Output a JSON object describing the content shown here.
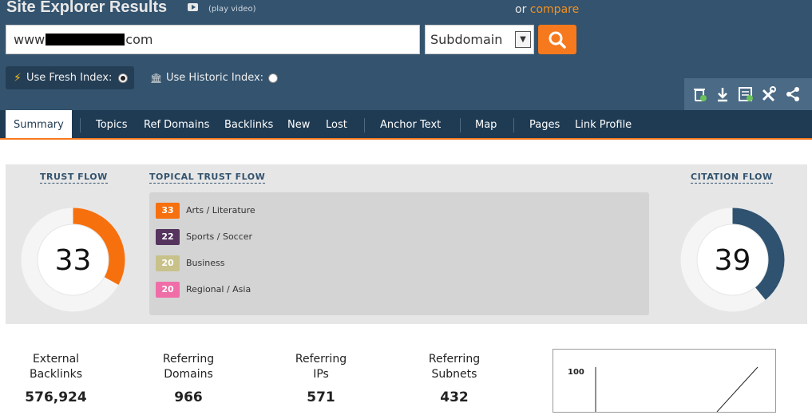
{
  "header": {
    "title": "Site Explorer Results",
    "play_video": "(play video)",
    "or": "or",
    "compare": "compare"
  },
  "search": {
    "url_prefix": "www",
    "url_suffix": "com",
    "scope": "Subdomain"
  },
  "index": {
    "fresh_label": "Use Fresh Index:",
    "historic_label": "Use Historic Index:",
    "selected": "fresh"
  },
  "tabs": [
    "Summary",
    "Topics",
    "Ref Domains",
    "Backlinks",
    "New",
    "Lost",
    "Anchor Text",
    "Map",
    "Pages",
    "Link Profile"
  ],
  "trust_flow": {
    "label": "TRUST FLOW",
    "value": "33",
    "color": "#f7700e"
  },
  "citation_flow": {
    "label": "CITATION FLOW",
    "value": "39",
    "color": "#2e5270"
  },
  "topical": {
    "label": "TOPICAL TRUST FLOW",
    "items": [
      {
        "value": "33",
        "label": "Arts / Literature",
        "color": "#f7700e"
      },
      {
        "value": "22",
        "label": "Sports / Soccer",
        "color": "#55345e"
      },
      {
        "value": "20",
        "label": "Business",
        "color": "#c8c28a"
      },
      {
        "value": "20",
        "label": "Regional / Asia",
        "color": "#f06ea8"
      }
    ]
  },
  "stats": [
    {
      "label1": "External",
      "label2": "Backlinks",
      "value": "576,924"
    },
    {
      "label1": "Referring",
      "label2": "Domains",
      "value": "966"
    },
    {
      "label1": "Referring",
      "label2": "IPs",
      "value": "571"
    },
    {
      "label1": "Referring",
      "label2": "Subnets",
      "value": "432"
    }
  ],
  "mini_chart": {
    "y_label": "100"
  },
  "toolbar_icons": [
    "bin-icon",
    "download-icon",
    "report-icon",
    "tools-icon",
    "share-icon"
  ]
}
